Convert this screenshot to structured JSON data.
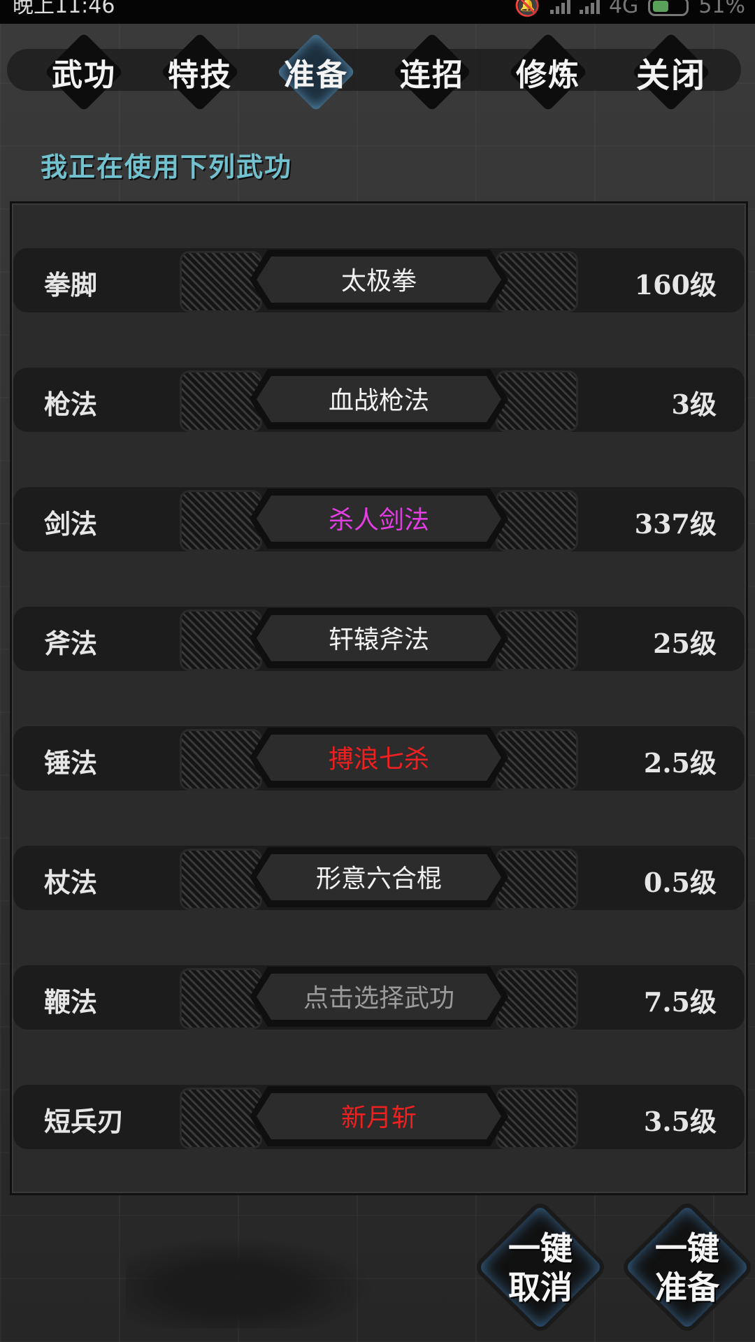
{
  "status_bar": {
    "time": "晚上11:46",
    "network": "4G",
    "battery": "51%"
  },
  "tabs": [
    {
      "label": "武功",
      "active": false
    },
    {
      "label": "特技",
      "active": false
    },
    {
      "label": "准备",
      "active": true
    },
    {
      "label": "连招",
      "active": false
    },
    {
      "label": "修炼",
      "active": false
    },
    {
      "label": "关闭",
      "active": false
    }
  ],
  "section_title": "我正在使用下列武功",
  "rows": [
    {
      "category": "拳脚",
      "skill": "太极拳",
      "level": "160级",
      "color": "#f2f2f2"
    },
    {
      "category": "枪法",
      "skill": "血战枪法",
      "level": "3级",
      "color": "#f2f2f2"
    },
    {
      "category": "剑法",
      "skill": "杀人剑法",
      "level": "337级",
      "color": "#e33ee3"
    },
    {
      "category": "斧法",
      "skill": "轩辕斧法",
      "level": "25级",
      "color": "#f2f2f2"
    },
    {
      "category": "锤法",
      "skill": "搏浪七杀",
      "level": "2.5级",
      "color": "#ee2020"
    },
    {
      "category": "杖法",
      "skill": "形意六合棍",
      "level": "0.5级",
      "color": "#f2f2f2"
    },
    {
      "category": "鞭法",
      "skill": "点击选择武功",
      "level": "7.5级",
      "color": "#9a9a9a"
    },
    {
      "category": "短兵刃",
      "skill": "新月斩",
      "level": "3.5级",
      "color": "#ee2020"
    }
  ],
  "buttons": {
    "cancel_line1": "一键",
    "cancel_line2": "取消",
    "ready_line1": "一键",
    "ready_line2": "准备"
  }
}
